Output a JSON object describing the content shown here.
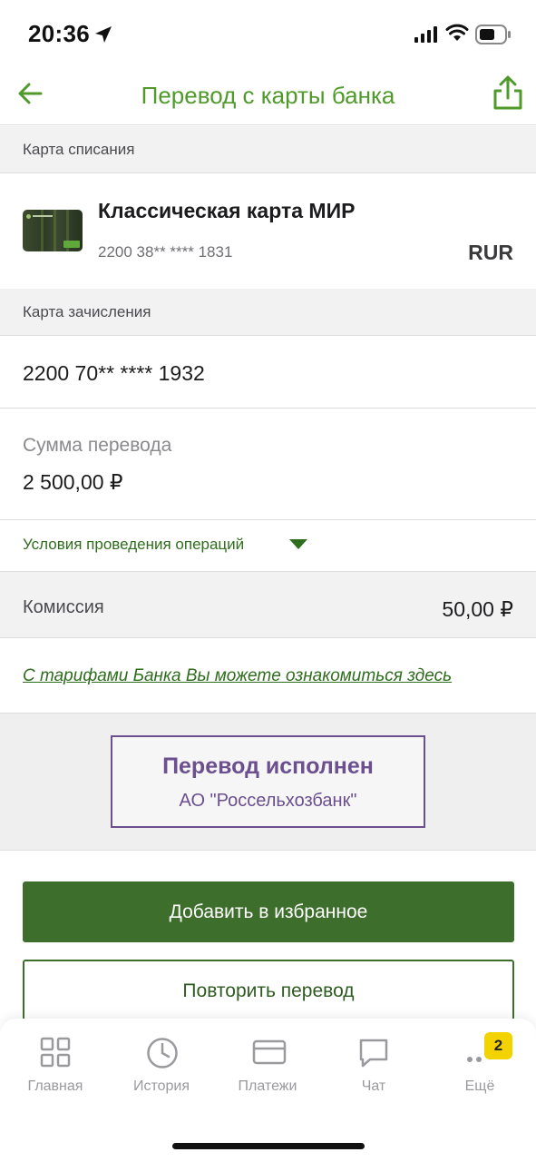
{
  "status_bar": {
    "time": "20:36"
  },
  "header": {
    "title": "Перевод с карты банка"
  },
  "source": {
    "section_label": "Карта списания",
    "card_name": "Классическая карта МИР",
    "card_number": "2200 38** **** 1831",
    "currency": "RUR"
  },
  "destination": {
    "section_label": "Карта зачисления",
    "card_number": "2200 70** **** 1932"
  },
  "amount": {
    "label": "Сумма перевода",
    "value": "2 500,00 ₽"
  },
  "conditions": {
    "label": "Условия проведения операций"
  },
  "commission": {
    "label": "Комиссия",
    "value": "50,00 ₽"
  },
  "tariffs_link": "С тарифами Банка Вы можете ознакомиться здесь",
  "stamp": {
    "title": "Перевод исполнен",
    "subtitle": "АО \"Россельхозбанк\""
  },
  "buttons": {
    "add_favorite": "Добавить в избранное",
    "repeat": "Повторить перевод"
  },
  "tab_bar": {
    "items": [
      {
        "label": "Главная",
        "icon": "grid-icon"
      },
      {
        "label": "История",
        "icon": "clock-icon"
      },
      {
        "label": "Платежи",
        "icon": "card-icon"
      },
      {
        "label": "Чат",
        "icon": "chat-icon"
      },
      {
        "label": "Ещё",
        "icon": "more-icon"
      }
    ],
    "more_badge": "2"
  },
  "colors": {
    "brand_green": "#4f9a2a",
    "button_green": "#3e6e2b",
    "stamp_purple": "#6b4f8f",
    "badge_yellow": "#f2d300"
  }
}
